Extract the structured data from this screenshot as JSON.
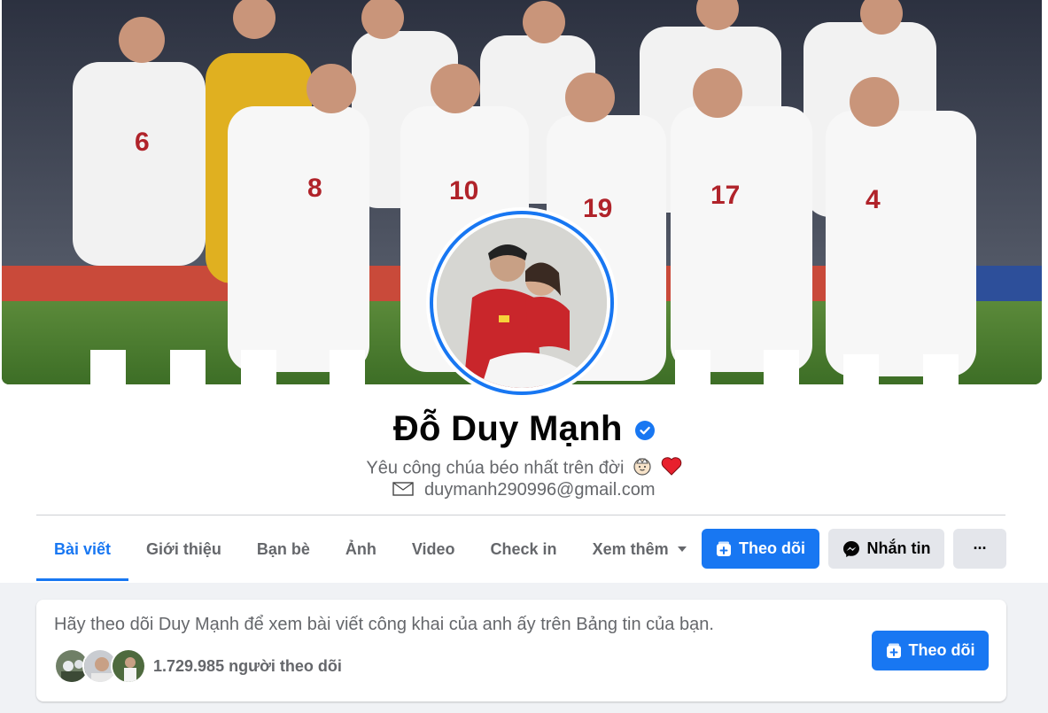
{
  "profile": {
    "name": "Đỗ Duy Mạnh",
    "verified_icon": "verified-badge-icon",
    "bio": "Yêu công chúa béo nhất trên đời",
    "bio_emojis": [
      "princess-emoji",
      "red-heart-emoji"
    ],
    "email_icon": "envelope-icon",
    "email": "duymanh290996@gmail.com"
  },
  "tabs": [
    {
      "label": "Bài viết",
      "active": true
    },
    {
      "label": "Giới thiệu"
    },
    {
      "label": "Bạn bè"
    },
    {
      "label": "Ảnh"
    },
    {
      "label": "Video"
    },
    {
      "label": "Check in"
    },
    {
      "label": "Xem thêm"
    }
  ],
  "actions": {
    "follow_label": "Theo dõi",
    "message_label": "Nhắn tin",
    "more_label": "···"
  },
  "follow_card": {
    "message": "Hãy theo dõi Duy Mạnh để xem bài viết công khai của anh ấy trên Bảng tin của bạn.",
    "followers_text": "1.729.985 người theo dõi",
    "button_label": "Theo dõi"
  },
  "colors": {
    "accent": "#1877f2",
    "text_primary": "#050505",
    "text_secondary": "#65676b",
    "secondary_button": "#e4e6eb",
    "background": "#f0f2f5"
  }
}
